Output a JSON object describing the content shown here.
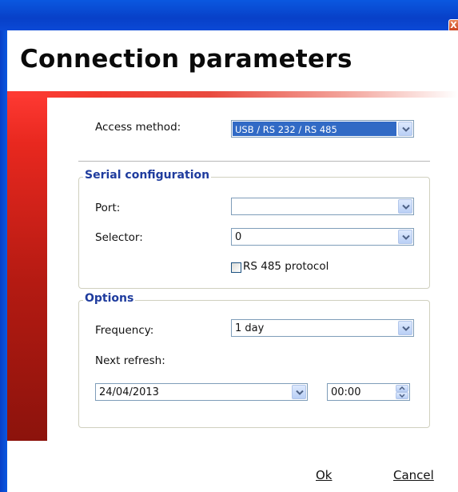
{
  "window": {
    "title": "Connection parameters",
    "close_glyph": "X"
  },
  "access": {
    "label": "Access method:",
    "value": "USB / RS 232 / RS 485"
  },
  "serial": {
    "group_title": "Serial configuration",
    "port_label": "Port:",
    "port_value": "",
    "selector_label": "Selector:",
    "selector_value": "0",
    "rs485_label": "RS 485 protocol",
    "rs485_checked": false
  },
  "options": {
    "group_title": "Options",
    "frequency_label": "Frequency:",
    "frequency_value": "1 day",
    "next_refresh_label": "Next refresh:",
    "date_value": "24/04/2013",
    "time_value": "00:00"
  },
  "footer": {
    "ok_label": "Ok",
    "cancel_label": "Cancel"
  },
  "icons": {
    "dropdown": "chevron-down-icon",
    "spin_up": "spin-up-icon",
    "spin_down": "spin-down-icon"
  },
  "colors": {
    "titlebar": "#0a58e0",
    "accent_red": "#e8281f",
    "group_title": "#1f3c9e",
    "selection": "#316ac5"
  }
}
